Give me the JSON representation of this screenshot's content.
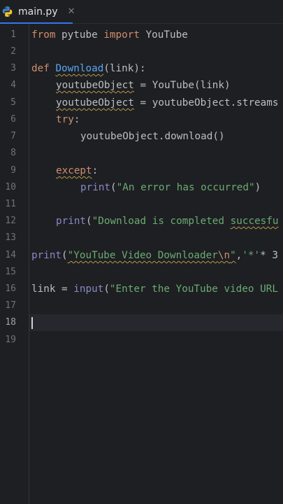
{
  "tab": {
    "filename": "main.py",
    "close_glyph": "✕",
    "icon": "python-file-icon"
  },
  "gutter": {
    "line_numbers": [
      "1",
      "2",
      "3",
      "4",
      "5",
      "6",
      "7",
      "8",
      "9",
      "10",
      "11",
      "12",
      "13",
      "14",
      "15",
      "16",
      "17",
      "18",
      "19"
    ],
    "current_line": "18"
  },
  "code": {
    "line1": {
      "kw1": "from",
      "mod": " pytube ",
      "kw2": "import",
      "cls": " YouTube"
    },
    "line3": {
      "kw": "def",
      "sp": " ",
      "name": "Download",
      "rest": "(link):"
    },
    "line4": {
      "var": "youtubeObject",
      "rest": " = YouTube(link)"
    },
    "line5": {
      "var": "youtubeObject",
      "rest": " = youtubeObject.streams"
    },
    "line6": {
      "kw": "try",
      "rest": ":"
    },
    "line7": {
      "text": "youtubeObject.download()"
    },
    "line9": {
      "kw": "except",
      "rest": ":"
    },
    "line10": {
      "fn": "print",
      "open": "(",
      "str": "\"An error has occurred\"",
      "close": ")"
    },
    "line12": {
      "fn": "print",
      "open": "(",
      "str1": "\"Download is completed ",
      "str2": "succesfu"
    },
    "line14": {
      "fn": "print",
      "open": "(",
      "str1": "\"YouTube Video Downloader",
      "esc": "\\n",
      "str2": "\"",
      "comma": ",",
      "str3": "'*'",
      "rest": "* 3"
    },
    "line16": {
      "pre": "link = ",
      "fn": "input",
      "open": "(",
      "str": "\"Enter the YouTube video URL"
    }
  },
  "colors": {
    "background": "#1e1f22",
    "keyword": "#cf8e6d",
    "function": "#56a8f5",
    "string": "#6aab73",
    "builtin": "#8888c6",
    "text": "#bcbec4",
    "tab_underline": "#3574f0"
  }
}
